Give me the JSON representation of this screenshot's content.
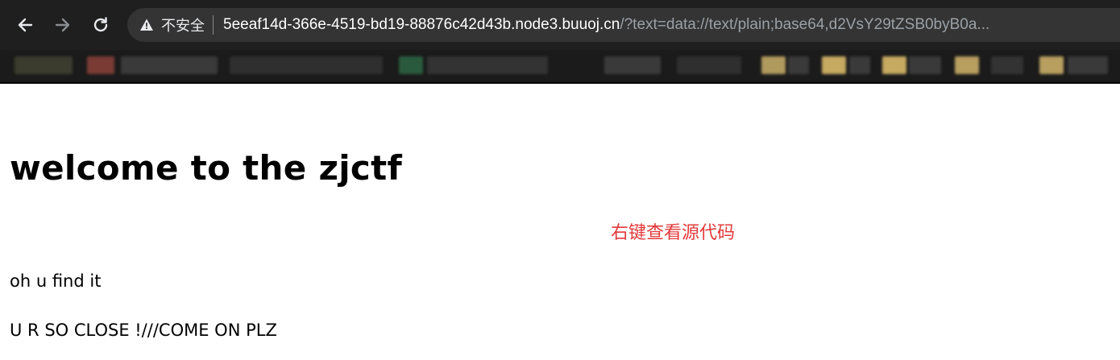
{
  "browser": {
    "nav": {
      "back_icon": "arrow-left-icon",
      "forward_icon": "arrow-right-icon",
      "reload_icon": "reload-icon"
    },
    "omnibox": {
      "security_icon": "warning-triangle-icon",
      "security_label": "不安全",
      "url_host": "5eeaf14d-366e-4519-bd19-88876c42d43b.node3.buuoj.cn",
      "url_rest": "/?text=data://text/plain;base64,d2VsY29tZSB0byB0a..."
    },
    "colors": {
      "toolbar_bg": "#1f1f1f",
      "omnibox_bg": "#343434",
      "host_text": "#ffffff",
      "path_text": "#9aa0a6"
    }
  },
  "page": {
    "title": "welcome to the zjctf",
    "hint": "右键查看源代码",
    "hint_color": "#e23a3a",
    "paragraphs": [
      "oh u find it",
      "U R SO CLOSE !///COME ON PLZ"
    ]
  }
}
